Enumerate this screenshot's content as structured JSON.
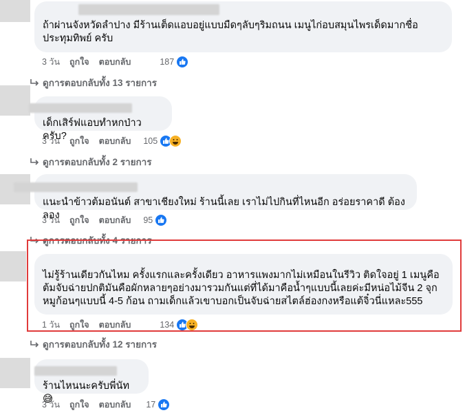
{
  "comments": [
    {
      "text": "ถ้าผ่านจังหวัดลำปาง มีร้านเต็ดแอบอยู่แบบมืดๆลับๆริมถนน เมนูไก่อบสมุนไพรเด็ดมากชื่อ ประทุมทิพย์ ครับ",
      "time": "3 วัน",
      "like_label": "ถูกใจ",
      "reply_label": "ตอบกลับ",
      "reaction_count": "187",
      "view_replies": "ดูการตอบกลับทั้ง 13 รายการ"
    },
    {
      "text": "เด็กเสิร์ฟแอบทำหกป่าวครับ?",
      "time": "3 วัน",
      "like_label": "ถูกใจ",
      "reply_label": "ตอบกลับ",
      "reaction_count": "105",
      "view_replies": "ดูการตอบกลับทั้ง 2 รายการ"
    },
    {
      "text": "แนะนำข้าวต้มอนันต์ สาขาเชียงใหม่ ร้านนี้เลย เราไม่ไปกินที่ไหนอีก อร่อยราคาดี ต้องลอง",
      "time": "3 วัน",
      "like_label": "ถูกใจ",
      "reply_label": "ตอบกลับ",
      "reaction_count": "95",
      "view_replies": "ดูการตอบกลับทั้ง 4 รายการ"
    },
    {
      "text": "ไม่รู้ร้านเดียวกันไหม ครั้งแรกและครั้งเดียว อาหารแพงมากไม่เหมือนในรีวิว ติดใจอยู่ 1 เมนูคือต้มจับฉ่ายปกติมันคือผักหลายๆอย่างมารวมกันแต่ที่ได้มาคือน้ำๆแบบนี้เลยค่ะมีหน่อไม้จีน 2 จุก หมูก้อนๆแบบนี้ 4-5 ก้อน ถามเด็กแล้วเขาบอกเป็นจับฉ่ายสไตล์ฮ่องกงหรือแต้จิ๋วนี่แหละ555",
      "time": "1 วัน",
      "like_label": "ถูกใจ",
      "reply_label": "ตอบกลับ",
      "reaction_count": "134",
      "view_replies": "ดูการตอบกลับทั้ง 12 รายการ"
    },
    {
      "text": "ร้านไหนนะครับพี่นัท 😅",
      "time": "3 วัน",
      "like_label": "ถูกใจ",
      "reply_label": "ตอบกลับ",
      "reaction_count": "17"
    }
  ],
  "colors": {
    "like": "#1877f2",
    "haha": "#f7b125",
    "highlight": "#e03a3a",
    "bubble": "#f0f2f5"
  }
}
